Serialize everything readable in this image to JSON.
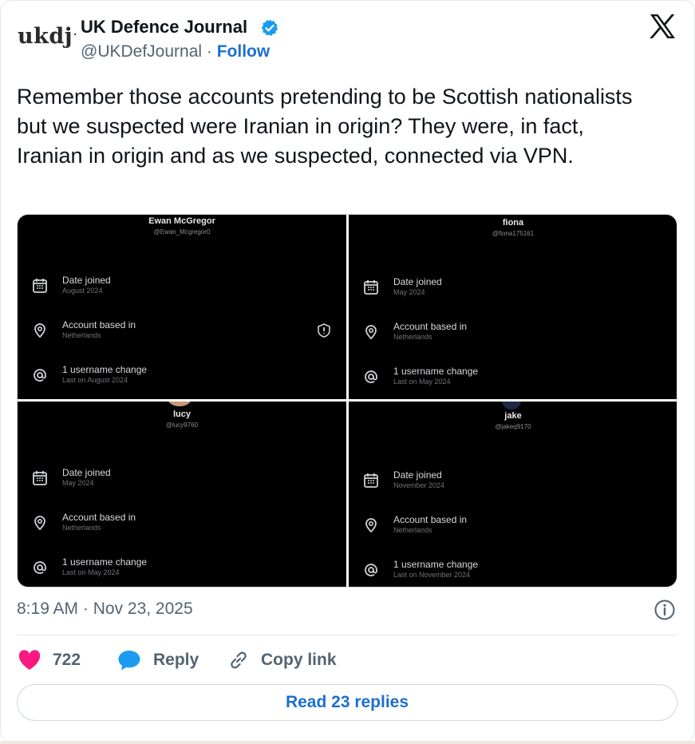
{
  "header": {
    "logo_text": "ukdj",
    "author_name": "UK Defence Journal",
    "handle": "@UKDefJournal",
    "separator": "·",
    "follow_label": "Follow",
    "verified_color": "#1d9bf0"
  },
  "tweet": {
    "text": "Remember those accounts pretending to be Scottish nationalists but we suspected were Iranian in origin? They were, in fact, Iranian in origin and as we suspected, connected via VPN."
  },
  "media": {
    "panels": [
      {
        "name": "Ewan McGregor",
        "handle": "@Ewan_Mcgregor0",
        "rows": [
          {
            "title": "Date joined",
            "sub": "August 2024",
            "icon": "calendar-icon"
          },
          {
            "title": "Account based in",
            "sub": "Netherlands",
            "icon": "location-pin-icon"
          },
          {
            "title": "1 username change",
            "sub": "Last on August 2024",
            "icon": "at-sign-icon"
          }
        ]
      },
      {
        "name": "fiona",
        "handle": "@fiona175161",
        "rows": [
          {
            "title": "Date joined",
            "sub": "May 2024",
            "icon": "calendar-icon"
          },
          {
            "title": "Account based in",
            "sub": "Netherlands",
            "icon": "location-pin-icon"
          },
          {
            "title": "1 username change",
            "sub": "Last on May 2024",
            "icon": "at-sign-icon"
          }
        ]
      },
      {
        "name": "lucy",
        "handle": "@lucy9760",
        "rows": [
          {
            "title": "Date joined",
            "sub": "May 2024",
            "icon": "calendar-icon"
          },
          {
            "title": "Account based in",
            "sub": "Netherlands",
            "icon": "location-pin-icon"
          },
          {
            "title": "1 username change",
            "sub": "Last on May 2024",
            "icon": "at-sign-icon"
          }
        ]
      },
      {
        "name": "jake",
        "handle": "@jakeq9170",
        "rows": [
          {
            "title": "Date joined",
            "sub": "November 2024",
            "icon": "calendar-icon"
          },
          {
            "title": "Account based in",
            "sub": "Netherlands",
            "icon": "location-pin-icon"
          },
          {
            "title": "1 username change",
            "sub": "Last on November 2024",
            "icon": "at-sign-icon"
          }
        ]
      }
    ]
  },
  "footer": {
    "timestamp": "8:19 AM · Nov 23, 2025",
    "like_count": "722",
    "reply_label": "Reply",
    "copy_link_label": "Copy link",
    "read_replies_label": "Read 23 replies",
    "like_color": "#f91880",
    "reply_color": "#1d9bf0"
  }
}
